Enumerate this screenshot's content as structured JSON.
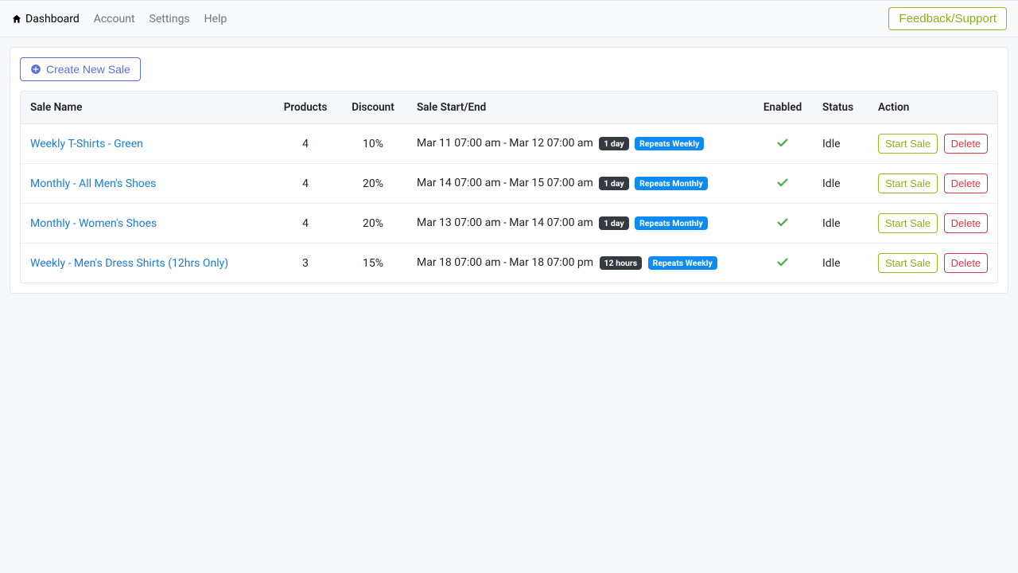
{
  "nav": {
    "dashboard": "Dashboard",
    "account": "Account",
    "settings": "Settings",
    "help": "Help",
    "feedback": "Feedback/Support"
  },
  "actions": {
    "create": "Create New Sale",
    "start": "Start Sale",
    "delete": "Delete"
  },
  "columns": {
    "name": "Sale Name",
    "products": "Products",
    "discount": "Discount",
    "start": "Sale Start/End",
    "enabled": "Enabled",
    "status": "Status",
    "action": "Action"
  },
  "rows": [
    {
      "name": "Weekly T-Shirts - Green",
      "products": "4",
      "discount": "10%",
      "range": "Mar 11 07:00 am - Mar 12 07:00 am",
      "duration": "1 day",
      "repeat": "Repeats Weekly",
      "status": "Idle"
    },
    {
      "name": "Monthly - All Men's Shoes",
      "products": "4",
      "discount": "20%",
      "range": "Mar 14 07:00 am - Mar 15 07:00 am",
      "duration": "1 day",
      "repeat": "Repeats Monthly",
      "status": "Idle"
    },
    {
      "name": "Monthly - Women's Shoes",
      "products": "4",
      "discount": "20%",
      "range": "Mar 13 07:00 am - Mar 14 07:00 am",
      "duration": "1 day",
      "repeat": "Repeats Monthly",
      "status": "Idle"
    },
    {
      "name": "Weekly - Men's Dress Shirts (12hrs Only)",
      "products": "3",
      "discount": "15%",
      "range": "Mar 18 07:00 am - Mar 18 07:00 pm",
      "duration": "12 hours",
      "repeat": "Repeats Weekly",
      "status": "Idle"
    }
  ]
}
